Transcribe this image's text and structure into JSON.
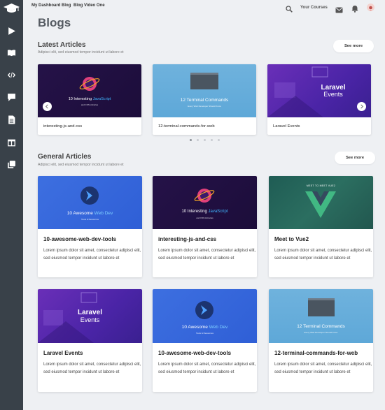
{
  "header": {
    "breadcrumbs": [
      "My Dashboard",
      "Blog",
      "Blog Video One"
    ],
    "your_courses": "Your Courses"
  },
  "sidebar": {
    "items": [
      {
        "icon": "graduation-cap-icon"
      },
      {
        "icon": "play-icon"
      },
      {
        "icon": "book-icon"
      },
      {
        "icon": "code-icon"
      },
      {
        "icon": "chat-icon"
      },
      {
        "icon": "document-icon"
      },
      {
        "icon": "columns-icon"
      },
      {
        "icon": "copy-icon"
      }
    ]
  },
  "page": {
    "title": "Blogs"
  },
  "latest": {
    "title": "Latest Articles",
    "subtitle": "Adipisci elit, sed eiusmod tempor incidunt ut labore et",
    "see_more": "See more",
    "cards": [
      {
        "caption": "interesting-js-and-css",
        "thumb": {
          "title_a": "10 Interesting ",
          "title_b": "JavaScript",
          "sub": "and CSS Libraries"
        }
      },
      {
        "caption": "12-terminal-commands-for-web",
        "thumb": {
          "title": "12 Terminal Commands",
          "sub": "Every Web Developer Should Know"
        }
      },
      {
        "caption": "Laravel Events",
        "thumb": {
          "title": "Laravel",
          "title2": "Events"
        }
      }
    ]
  },
  "general": {
    "title": "General Articles",
    "subtitle": "Adipisci elit, sed eiusmod tempor incidunt ut labore et",
    "see_more": "See more",
    "cards": [
      {
        "title": "10-awesome-web-dev-tools",
        "body": "Lorem ipsum dolor sit amet, consectetur adipisci elit, sed eiusmod tempor incidunt ut labore et",
        "thumb": {
          "title_a": "10 Awesome ",
          "title_b": "Web Dev",
          "sub": "Tools & Resources"
        }
      },
      {
        "title": "interesting-js-and-css",
        "body": "Lorem ipsum dolor sit amet, consectetur adipisci elit, sed eiusmod tempor incidunt ut labore et",
        "thumb": {
          "title_a": "10 Interesting ",
          "title_b": "JavaScript",
          "sub": "and CSS Libraries"
        }
      },
      {
        "title": "Meet to Vue2",
        "body": "Lorem ipsum dolor sit amet, consectetur adipisci elit, sed eiusmod tempor incidunt ut labore et",
        "thumb": {
          "label": "MEET TO MEET VUE2"
        }
      },
      {
        "title": "Laravel Events",
        "body": "Lorem ipsum dolor sit amet, consectetur adipisci elit, sed eiusmod tempor incidunt ut labore et",
        "thumb": {
          "title": "Laravel",
          "title2": "Events"
        }
      },
      {
        "title": "10-awesome-web-dev-tools",
        "body": "Lorem ipsum dolor sit amet, consectetur adipisci elit, sed eiusmod tempor incidunt ut labore et",
        "thumb": {
          "title_a": "10 Awesome ",
          "title_b": "Web Dev",
          "sub": "Tools & Resources"
        }
      },
      {
        "title": "12-terminal-commands-for-web",
        "body": "Lorem ipsum dolor sit amet, consectetur adipisci elit, sed eiusmod tempor incidunt ut labore et",
        "thumb": {
          "title": "12 Terminal Commands",
          "sub": "Every Web Developer Should Know"
        }
      }
    ]
  },
  "carousel": {
    "pages": 5,
    "active": 0
  },
  "colors": {
    "sidebar": "#394149",
    "accent_blue": "#3fb6ff",
    "accent_green": "#41b883"
  }
}
